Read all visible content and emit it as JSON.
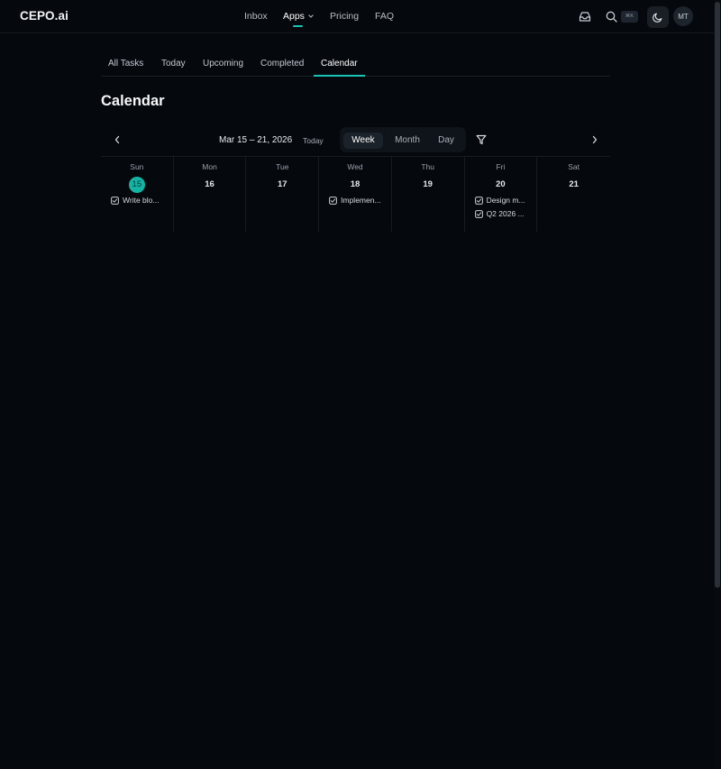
{
  "brand": {
    "logo": "CEPO.ai"
  },
  "nav": {
    "items": [
      {
        "label": "Inbox"
      },
      {
        "label": "Apps"
      },
      {
        "label": "Pricing"
      },
      {
        "label": "FAQ"
      }
    ]
  },
  "header": {
    "search_shortcut": "⌘K",
    "avatar_initials": "MT"
  },
  "tabs": [
    {
      "label": "All Tasks"
    },
    {
      "label": "Today"
    },
    {
      "label": "Upcoming"
    },
    {
      "label": "Completed"
    },
    {
      "label": "Calendar"
    }
  ],
  "page": {
    "title": "Calendar"
  },
  "toolbar": {
    "range": "Mar 15 – 21, 2026",
    "today_label": "Today",
    "views": [
      {
        "label": "Week"
      },
      {
        "label": "Month"
      },
      {
        "label": "Day"
      }
    ]
  },
  "week": [
    {
      "dow": "Sun",
      "day": "15",
      "tasks": [
        "Write blo..."
      ]
    },
    {
      "dow": "Mon",
      "day": "16",
      "tasks": []
    },
    {
      "dow": "Tue",
      "day": "17",
      "tasks": []
    },
    {
      "dow": "Wed",
      "day": "18",
      "tasks": [
        "Implemen..."
      ]
    },
    {
      "dow": "Thu",
      "day": "19",
      "tasks": []
    },
    {
      "dow": "Fri",
      "day": "20",
      "tasks": [
        "Design m...",
        "Q2 2026 ..."
      ]
    },
    {
      "dow": "Sat",
      "day": "21",
      "tasks": []
    }
  ],
  "colors": {
    "accent": "#19c3b1",
    "today_badge": "#14b3a3",
    "background": "#05080d"
  }
}
